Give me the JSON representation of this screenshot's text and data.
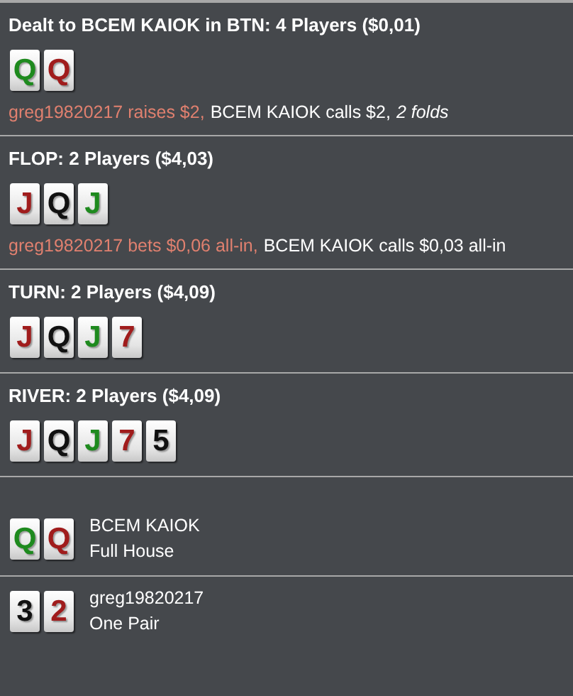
{
  "streets": [
    {
      "title": "Dealt to BCEM KAIOK in BTN: 4 Players ($0,01)",
      "cards": [
        {
          "rank": "Q",
          "color": "#1e8a1e"
        },
        {
          "rank": "Q",
          "color": "#a01c1c"
        }
      ],
      "actions": [
        {
          "text": "greg19820217 raises $2,",
          "kind": "opponent"
        },
        {
          "text": "BCEM KAIOK calls $2,",
          "kind": "hero"
        },
        {
          "text": "2 folds",
          "kind": "summary"
        }
      ]
    },
    {
      "title": "FLOP: 2 Players ($4,03)",
      "cards": [
        {
          "rank": "J",
          "color": "#a01c1c"
        },
        {
          "rank": "Q",
          "color": "#111111"
        },
        {
          "rank": "J",
          "color": "#1e8a1e"
        }
      ],
      "actions": [
        {
          "text": "greg19820217 bets $0,06 all-in,",
          "kind": "opponent"
        },
        {
          "text": "BCEM KAIOK calls $0,03 all-in",
          "kind": "hero"
        }
      ]
    },
    {
      "title": "TURN: 2 Players ($4,09)",
      "cards": [
        {
          "rank": "J",
          "color": "#a01c1c"
        },
        {
          "rank": "Q",
          "color": "#111111"
        },
        {
          "rank": "J",
          "color": "#1e8a1e"
        },
        {
          "rank": "7",
          "color": "#a01c1c"
        }
      ]
    },
    {
      "title": "RIVER: 2 Players ($4,09)",
      "cards": [
        {
          "rank": "J",
          "color": "#a01c1c"
        },
        {
          "rank": "Q",
          "color": "#111111"
        },
        {
          "rank": "J",
          "color": "#1e8a1e"
        },
        {
          "rank": "7",
          "color": "#a01c1c"
        },
        {
          "rank": "5",
          "color": "#111111"
        }
      ]
    }
  ],
  "showdown": [
    {
      "player": "BCEM KAIOK",
      "hand": "Full House",
      "cards": [
        {
          "rank": "Q",
          "color": "#1e8a1e"
        },
        {
          "rank": "Q",
          "color": "#a01c1c"
        }
      ]
    },
    {
      "player": "greg19820217",
      "hand": "One Pair",
      "cards": [
        {
          "rank": "3",
          "color": "#111111"
        },
        {
          "rank": "2",
          "color": "#a01c1c"
        }
      ]
    }
  ]
}
